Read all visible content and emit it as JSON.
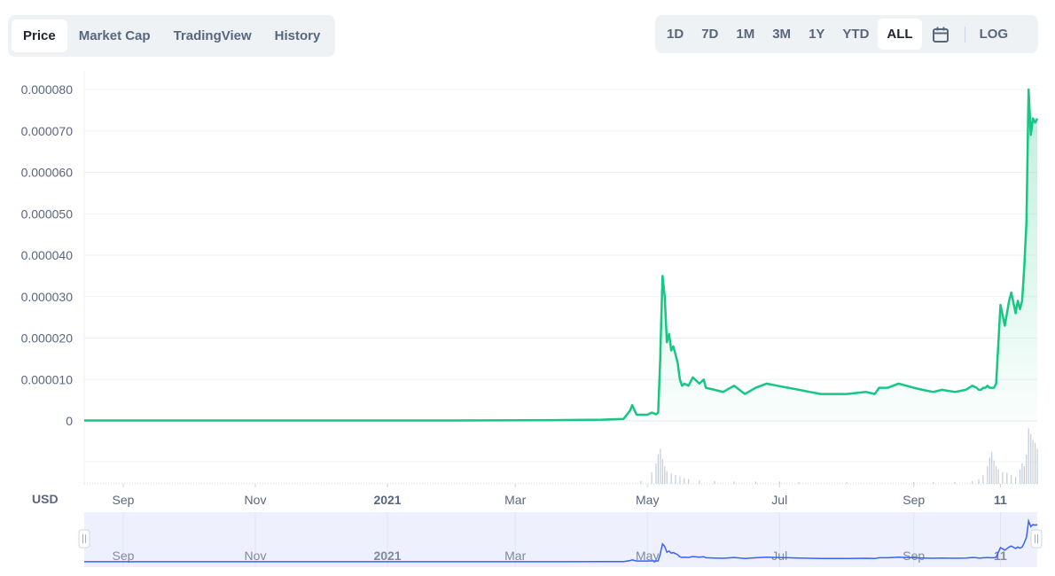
{
  "tabs": [
    {
      "label": "Price",
      "active": true
    },
    {
      "label": "Market Cap",
      "active": false
    },
    {
      "label": "TradingView",
      "active": false
    },
    {
      "label": "History",
      "active": false
    }
  ],
  "ranges": [
    {
      "label": "1D",
      "active": false
    },
    {
      "label": "7D",
      "active": false
    },
    {
      "label": "1M",
      "active": false
    },
    {
      "label": "3M",
      "active": false
    },
    {
      "label": "1Y",
      "active": false
    },
    {
      "label": "YTD",
      "active": false
    },
    {
      "label": "ALL",
      "active": true
    }
  ],
  "log_label": "LOG",
  "currency_label": "USD",
  "colors": {
    "line": "#16c784",
    "navigator_line": "#3861fb",
    "navigator_bg": "#eef1fd"
  },
  "icons": {
    "calendar": "calendar-icon"
  },
  "chart_data": {
    "type": "line",
    "yticks": [
      "0.000080",
      "0.000070",
      "0.000060",
      "0.000050",
      "0.000040",
      "0.000030",
      "0.000020",
      "0.000010",
      "0"
    ],
    "ylim": [
      0,
      8e-05
    ],
    "xticks": [
      {
        "label": "Sep",
        "date": "2020-09-01",
        "bold": false
      },
      {
        "label": "Nov",
        "date": "2020-11-01",
        "bold": false
      },
      {
        "label": "2021",
        "date": "2021-01-01",
        "bold": true
      },
      {
        "label": "Mar",
        "date": "2021-03-01",
        "bold": false
      },
      {
        "label": "May",
        "date": "2021-05-01",
        "bold": false
      },
      {
        "label": "Jul",
        "date": "2021-07-01",
        "bold": false
      },
      {
        "label": "Sep",
        "date": "2021-09-01",
        "bold": false
      },
      {
        "label": "11",
        "date": "2021-10-11",
        "bold": true
      }
    ],
    "xlim": [
      "2020-08-14",
      "2021-10-28"
    ],
    "grid": true,
    "series": [
      {
        "x": [
          "2020-08-14",
          "2020-10-01",
          "2020-12-01",
          "2021-02-01",
          "2021-03-20",
          "2021-04-10",
          "2021-04-20",
          "2021-04-23",
          "2021-04-24",
          "2021-04-26",
          "2021-04-28",
          "2021-05-01",
          "2021-05-03",
          "2021-05-05",
          "2021-05-06",
          "2021-05-07",
          "2021-05-07",
          "2021-05-08",
          "2021-05-09",
          "2021-05-10",
          "2021-05-11",
          "2021-05-12",
          "2021-05-13",
          "2021-05-14",
          "2021-05-15",
          "2021-05-16",
          "2021-05-17",
          "2021-05-18",
          "2021-05-20",
          "2021-05-22",
          "2021-05-25",
          "2021-05-27",
          "2021-05-28",
          "2021-06-01",
          "2021-06-05",
          "2021-06-10",
          "2021-06-15",
          "2021-06-20",
          "2021-06-25",
          "2021-06-30",
          "2021-07-05",
          "2021-07-10",
          "2021-07-15",
          "2021-07-20",
          "2021-07-25",
          "2021-08-01",
          "2021-08-10",
          "2021-08-14",
          "2021-08-16",
          "2021-08-20",
          "2021-08-25",
          "2021-09-01",
          "2021-09-05",
          "2021-09-10",
          "2021-09-14",
          "2021-09-20",
          "2021-09-25",
          "2021-09-28",
          "2021-09-30",
          "2021-10-01",
          "2021-10-02",
          "2021-10-03",
          "2021-10-04",
          "2021-10-05",
          "2021-10-06",
          "2021-10-08",
          "2021-10-09",
          "2021-10-11",
          "2021-10-13",
          "2021-10-15",
          "2021-10-16",
          "2021-10-18",
          "2021-10-19",
          "2021-10-20",
          "2021-10-21",
          "2021-10-22",
          "2021-10-23",
          "2021-10-24",
          "2021-10-25",
          "2021-10-26",
          "2021-10-27",
          "2021-10-28"
        ],
        "y": [
          1e-07,
          1e-07,
          1e-07,
          1e-07,
          2e-07,
          3e-07,
          5e-07,
          2.5e-06,
          3.8e-06,
          1.5e-06,
          1.5e-06,
          1.5e-06,
          2e-06,
          1.6e-06,
          2e-06,
          1.6e-05,
          1.7e-05,
          3.5e-05,
          3e-05,
          1.9e-05,
          2.1e-05,
          1.7e-05,
          1.8e-05,
          1.6e-05,
          1.4e-05,
          1e-05,
          8.5e-06,
          9e-06,
          8.5e-06,
          1.05e-05,
          9e-06,
          1e-05,
          8e-06,
          7.5e-06,
          7e-06,
          8.5e-06,
          6.5e-06,
          8e-06,
          9e-06,
          8.5e-06,
          8e-06,
          7.5e-06,
          7e-06,
          6.5e-06,
          6.5e-06,
          6.5e-06,
          7e-06,
          6.5e-06,
          8e-06,
          8e-06,
          9e-06,
          8e-06,
          7.5e-06,
          7e-06,
          7.5e-06,
          7e-06,
          7.5e-06,
          8.5e-06,
          8e-06,
          7.5e-06,
          7.5e-06,
          8e-06,
          8e-06,
          8.5e-06,
          8e-06,
          8e-06,
          9e-06,
          2.8e-05,
          2.3e-05,
          2.9e-05,
          3.1e-05,
          2.6e-05,
          2.9e-05,
          2.7e-05,
          2.9e-05,
          3.7e-05,
          4.8e-05,
          8e-05,
          6.9e-05,
          7.3e-05,
          7.2e-05,
          7.3e-05
        ]
      }
    ],
    "volume": {
      "x": [
        "2021-04-28",
        "2021-05-03",
        "2021-05-05",
        "2021-05-06",
        "2021-05-07",
        "2021-05-08",
        "2021-05-09",
        "2021-05-10",
        "2021-05-12",
        "2021-05-14",
        "2021-05-16",
        "2021-05-18",
        "2021-05-20",
        "2021-05-25",
        "2021-06-01",
        "2021-06-10",
        "2021-06-20",
        "2021-07-01",
        "2021-07-10",
        "2021-08-01",
        "2021-09-01",
        "2021-09-10",
        "2021-09-20",
        "2021-09-28",
        "2021-10-01",
        "2021-10-03",
        "2021-10-05",
        "2021-10-06",
        "2021-10-07",
        "2021-10-08",
        "2021-10-09",
        "2021-10-10",
        "2021-10-12",
        "2021-10-14",
        "2021-10-16",
        "2021-10-18",
        "2021-10-20",
        "2021-10-21",
        "2021-10-22",
        "2021-10-23",
        "2021-10-24",
        "2021-10-25",
        "2021-10-26",
        "2021-10-27",
        "2021-10-28"
      ],
      "v": [
        0.05,
        0.2,
        0.35,
        0.5,
        0.6,
        0.42,
        0.3,
        0.22,
        0.18,
        0.15,
        0.12,
        0.1,
        0.08,
        0.06,
        0.05,
        0.04,
        0.04,
        0.04,
        0.03,
        0.03,
        0.03,
        0.03,
        0.03,
        0.05,
        0.08,
        0.15,
        0.3,
        0.45,
        0.55,
        0.4,
        0.3,
        0.25,
        0.2,
        0.18,
        0.15,
        0.12,
        0.25,
        0.35,
        0.3,
        0.5,
        0.95,
        0.85,
        0.75,
        0.7,
        0.6
      ]
    }
  }
}
